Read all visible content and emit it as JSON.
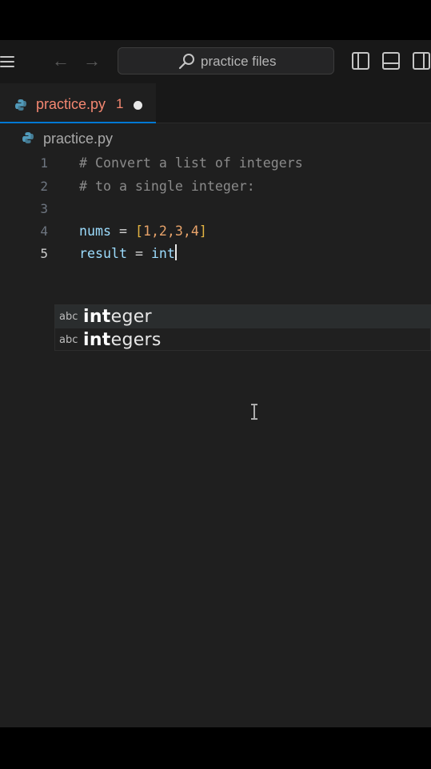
{
  "titlebar": {
    "search_label": "practice files"
  },
  "tabs": [
    {
      "label": "practice.py",
      "problem_count": "1",
      "modified": true
    }
  ],
  "breadcrumb": {
    "file": "practice.py"
  },
  "editor": {
    "lines": [
      {
        "number": "1",
        "text": "# Convert a list of integers"
      },
      {
        "number": "2",
        "text": "# to a single integer:"
      },
      {
        "number": "3",
        "text": ""
      },
      {
        "number": "4",
        "text": "nums = [1,2,3,4]"
      },
      {
        "number": "5",
        "text": "result = int"
      }
    ],
    "active_line": "5"
  },
  "suggestions": [
    {
      "kind": "abc",
      "label": "integer",
      "match": "int",
      "rest": "eger"
    },
    {
      "kind": "abc",
      "label": "integers",
      "match": "int",
      "rest": "egers"
    }
  ],
  "colors": {
    "accent": "#0078d4",
    "error_tab": "#f48771",
    "editor_bg": "#1f1f1f",
    "comment": "#8a8a8a",
    "identifier": "#9cdcfe",
    "number": "#e8a36a"
  },
  "icons": [
    "menu-icon",
    "back-arrow-icon",
    "forward-arrow-icon",
    "search-icon",
    "toggle-primary-sidebar-icon",
    "toggle-panel-icon",
    "toggle-secondary-sidebar-icon",
    "python-file-icon",
    "text-cursor-icon"
  ]
}
